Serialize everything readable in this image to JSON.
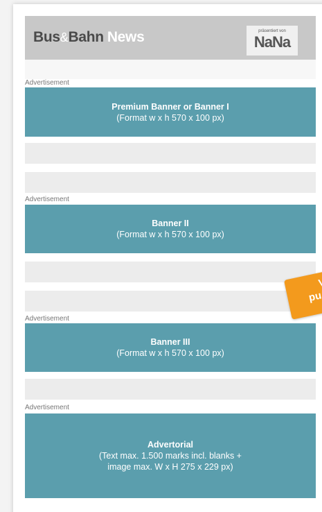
{
  "header": {
    "logo_bus": "Bus",
    "logo_amp": "&",
    "logo_bahn": "Bahn",
    "logo_news": "News",
    "presented_label": "präsentiert von",
    "presented_brand": "NaNa"
  },
  "ads": [
    {
      "label": "Advertisement",
      "title": "Premium Banner or Banner I",
      "subtitle": "(Format w x h 570 x 100 px)"
    },
    {
      "label": "Advertisement",
      "title": "Banner II",
      "subtitle": "(Format w x h 570 x 100 px)"
    },
    {
      "label": "Advertisement",
      "title": "Banner III",
      "subtitle": "(Format w x h 570 x 100 px)"
    },
    {
      "label": "Advertisement",
      "title": "Advertorial",
      "subtitle": "(Text max. 1.500 marks incl. blanks +",
      "subtitle2": "image max. W x H 275 x 229 px)"
    }
  ],
  "badge": {
    "line1": "V",
    "line2": "pu"
  },
  "colors": {
    "banner": "#5b9ead",
    "header": "#c8c8c8",
    "badge": "#f39a1d"
  }
}
